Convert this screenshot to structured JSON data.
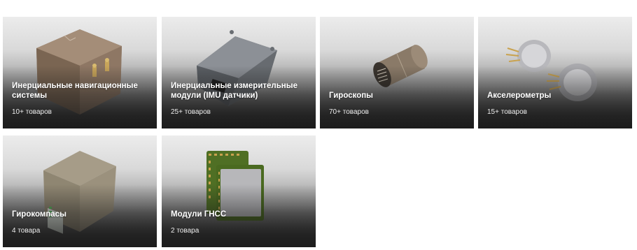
{
  "categories": [
    {
      "title": "Инерциальные навигационные системы",
      "count": "10+ товаров",
      "image": "ins-box-image"
    },
    {
      "title": "Инерциальные измерительные модули (IMU датчики)",
      "count": "25+ товаров",
      "image": "imu-module-image"
    },
    {
      "title": "Гироскопы",
      "count": "70+ товаров",
      "image": "gyroscope-cylinder-image"
    },
    {
      "title": "Акселерометры",
      "count": "15+ товаров",
      "image": "accelerometer-image"
    },
    {
      "title": "Гирокомпасы",
      "count": "4 товара",
      "image": "gyrocompass-box-image"
    },
    {
      "title": "Модули ГНСС",
      "count": "2 товара",
      "image": "gnss-module-image"
    }
  ]
}
